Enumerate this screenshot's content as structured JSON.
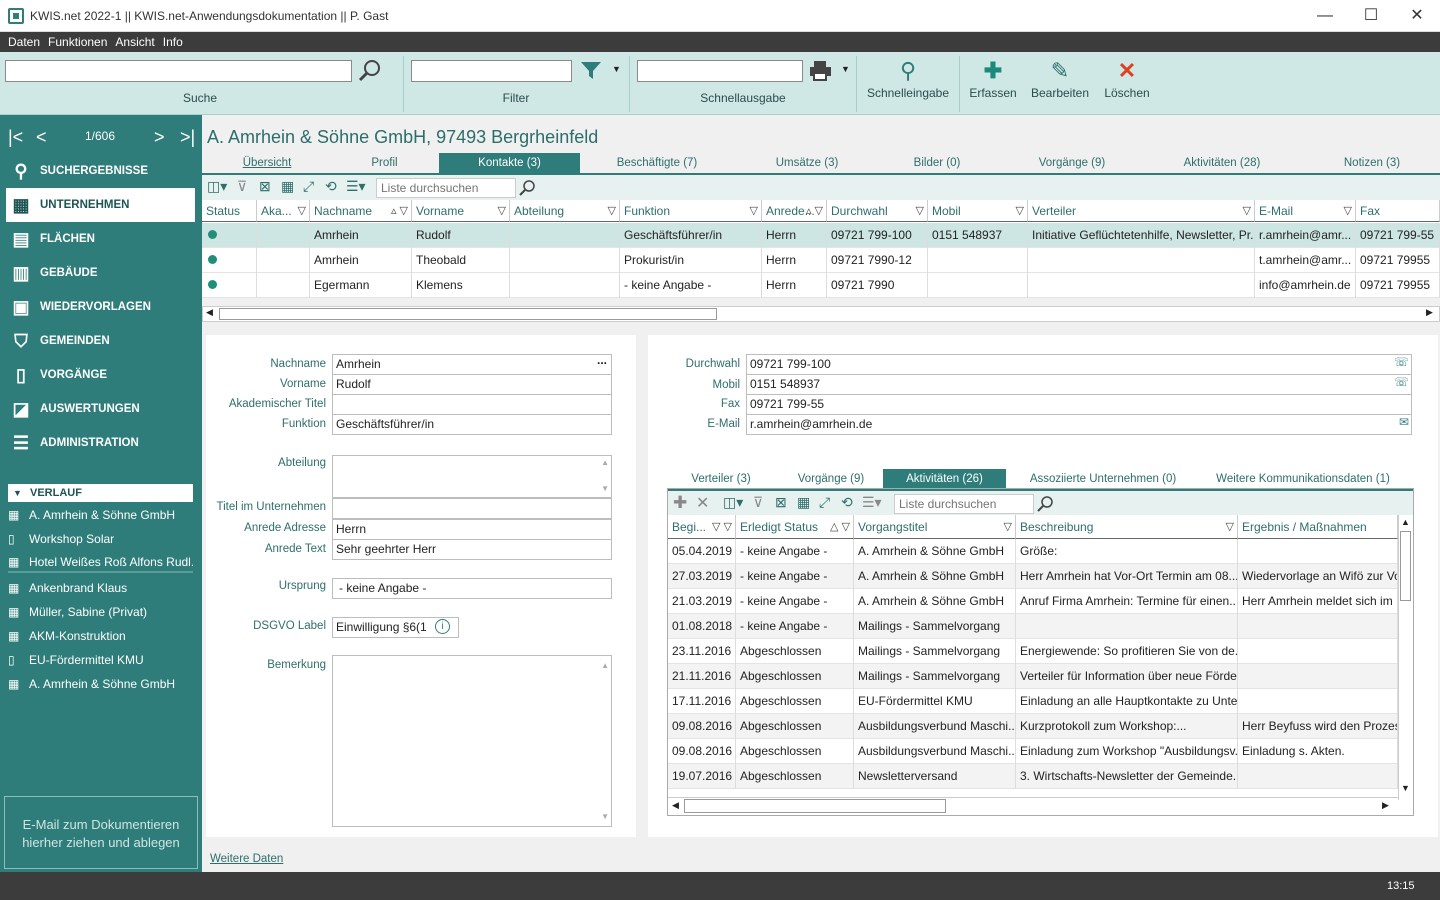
{
  "window": {
    "title": "KWIS.net 2022-1 || KWIS.net-Anwendungsdokumentation || P. Gast",
    "minimize": "—",
    "maximize": "☐",
    "close": "✕"
  },
  "menu": [
    "Daten",
    "Funktionen",
    "Ansicht",
    "Info"
  ],
  "toolbar": {
    "search_label": "Suche",
    "filter_label": "Filter",
    "quick_output_label": "Schnellausgabe",
    "quick_entry": "Schnelleingabe",
    "create": "Erfassen",
    "edit": "Bearbeiten",
    "delete": "Löschen",
    "search_value": "",
    "filter_value": "",
    "quick_output_value": ""
  },
  "nav": {
    "position": "1/606",
    "first": "|<",
    "prev": "<",
    "next": ">",
    "last": ">|",
    "items": [
      "SUCHERGEBNISSE",
      "UNTERNEHMEN",
      "FLÄCHEN",
      "GEBÄUDE",
      "WIEDERVORLAGEN",
      "GEMEINDEN",
      "VORGÄNGE",
      "AUSWERTUNGEN",
      "ADMINISTRATION"
    ]
  },
  "verlauf": {
    "header": "VERLAUF",
    "items": [
      "A. Amrhein & Söhne GmbH",
      "Workshop Solar",
      "Hotel Weißes Roß Alfons Rudl...",
      "Ankenbrand Klaus",
      "Müller, Sabine (Privat)",
      "AKM-Konstruktion",
      "EU-Fördermittel KMU",
      "A. Amrhein & Söhne GmbH"
    ]
  },
  "dropzone": {
    "line1": "E-Mail  zum Dokumentieren",
    "line2": "hierher ziehen und ablegen"
  },
  "company": "A. Amrhein & Söhne GmbH, 97493 Bergrheinfeld",
  "tabs": [
    "Übersicht",
    "Profil",
    "Kontakte (3)",
    "Beschäftigte (7)",
    "Umsätze (3)",
    "Bilder (0)",
    "Vorgänge (9)",
    "Aktivitäten (28)",
    "Notizen (3)"
  ],
  "contacts": {
    "search_placeholder": "Liste durchsuchen",
    "headers": [
      "Status",
      "Aka...",
      "Nachname",
      "Vorname",
      "Abteilung",
      "Funktion",
      "Anrede...",
      "Durchwahl",
      "Mobil",
      "Verteiler",
      "E-Mail",
      "Fax"
    ],
    "rows": [
      [
        "",
        "",
        "Amrhein",
        "Rudolf",
        "",
        "Geschäftsführer/in",
        "Herrn",
        "09721 799-100",
        "0151 548937",
        "Initiative Geflüchtetenhilfe, Newsletter, Pr...",
        "r.amrhein@amr...",
        "09721 799-55"
      ],
      [
        "",
        "",
        "Amrhein",
        "Theobald",
        "",
        "Prokurist/in",
        "Herrn",
        "09721 7990-12",
        "",
        "",
        "t.amrhein@amr...",
        "09721 79955"
      ],
      [
        "",
        "",
        "Egermann",
        "Klemens",
        "",
        "- keine Angabe -",
        "Herrn",
        "09721 7990",
        "",
        "",
        "info@amrhein.de",
        "09721 79955"
      ]
    ]
  },
  "details": {
    "nachname_label": "Nachname",
    "nachname": "Amrhein",
    "vorname_label": "Vorname",
    "vorname": "Rudolf",
    "titel_label": "Akademischer Titel",
    "titel": "",
    "funktion_label": "Funktion",
    "funktion": "Geschäftsführer/in",
    "abteilung_label": "Abteilung",
    "abteilung": "",
    "titel_unt_label": "Titel im Unternehmen",
    "titel_unt": "",
    "anrede_adr_label": "Anrede Adresse",
    "anrede_adr": "Herrn",
    "anrede_text_label": "Anrede Text",
    "anrede_text": "Sehr geehrter Herr",
    "ursprung_label": "Ursprung",
    "ursprung": "- keine Angabe -",
    "dsgvo_label": "DSGVO Label",
    "dsgvo": "Einwilligung §6(1",
    "bemerkung_label": "Bemerkung",
    "bemerkung": "",
    "more": "...",
    "more_data": "Weitere Daten"
  },
  "comm": {
    "durchwahl_label": "Durchwahl",
    "durchwahl": "09721 799-100",
    "mobil_label": "Mobil",
    "mobil": "0151 548937",
    "fax_label": "Fax",
    "fax": "09721 799-55",
    "email_label": "E-Mail",
    "email": "r.amrhein@amrhein.de"
  },
  "subtabs": [
    "Verteiler (3)",
    "Vorgänge (9)",
    "Aktivitäten (26)",
    "Assoziierte Unternehmen (0)",
    "Weitere Kommunikationsdaten (1)"
  ],
  "activities": {
    "search_placeholder": "Liste durchsuchen",
    "headers": [
      "Begi...",
      "Erledigt Status",
      "Vorgangstitel",
      "Beschreibung",
      "Ergebnis / Maßnahmen"
    ],
    "rows": [
      [
        "05.04.2019",
        "- keine Angabe -",
        "A. Amrhein & Söhne GmbH",
        "Größe:",
        ""
      ],
      [
        "27.03.2019",
        "- keine Angabe -",
        "A. Amrhein & Söhne GmbH",
        "Herr Amrhein hat Vor-Ort Termin am 08....",
        "Wiedervorlage an Wifö zur Vor"
      ],
      [
        "21.03.2019",
        "- keine Angabe -",
        "A. Amrhein & Söhne GmbH",
        "Anruf Firma Amrhein: Termine für einen...",
        "Herr Amrhein meldet sich im L"
      ],
      [
        "01.08.2018",
        "- keine Angabe -",
        "Mailings - Sammelvorgang",
        "",
        ""
      ],
      [
        "23.11.2016",
        "Abgeschlossen",
        "Mailings - Sammelvorgang",
        "Energiewende: So profitieren Sie von de...",
        ""
      ],
      [
        "21.11.2016",
        "Abgeschlossen",
        "Mailings - Sammelvorgang",
        "Verteiler für Information über neue Förde...",
        ""
      ],
      [
        "17.11.2016",
        "Abgeschlossen",
        "EU-Fördermittel KMU",
        "Einladung an alle Hauptkontakte zu Unte...",
        ""
      ],
      [
        "09.08.2016",
        "Abgeschlossen",
        "Ausbildungsverbund Maschi...",
        "Kurzprotokoll zum Workshop:...",
        "Herr Beyfuss wird den Prozess"
      ],
      [
        "09.08.2016",
        "Abgeschlossen",
        "Ausbildungsverbund Maschi...",
        "Einladung zum Workshop \"Ausbildungsv...",
        "Einladung s. Akten."
      ],
      [
        "19.07.2016",
        "Abgeschlossen",
        "Newsletterversand",
        "3. Wirtschafts-Newsletter der Gemeinde...",
        ""
      ]
    ]
  },
  "status": {
    "time": "13:15"
  },
  "colors": {
    "accent": "#2e7d7a",
    "toolbar": "#cfe8e6"
  }
}
